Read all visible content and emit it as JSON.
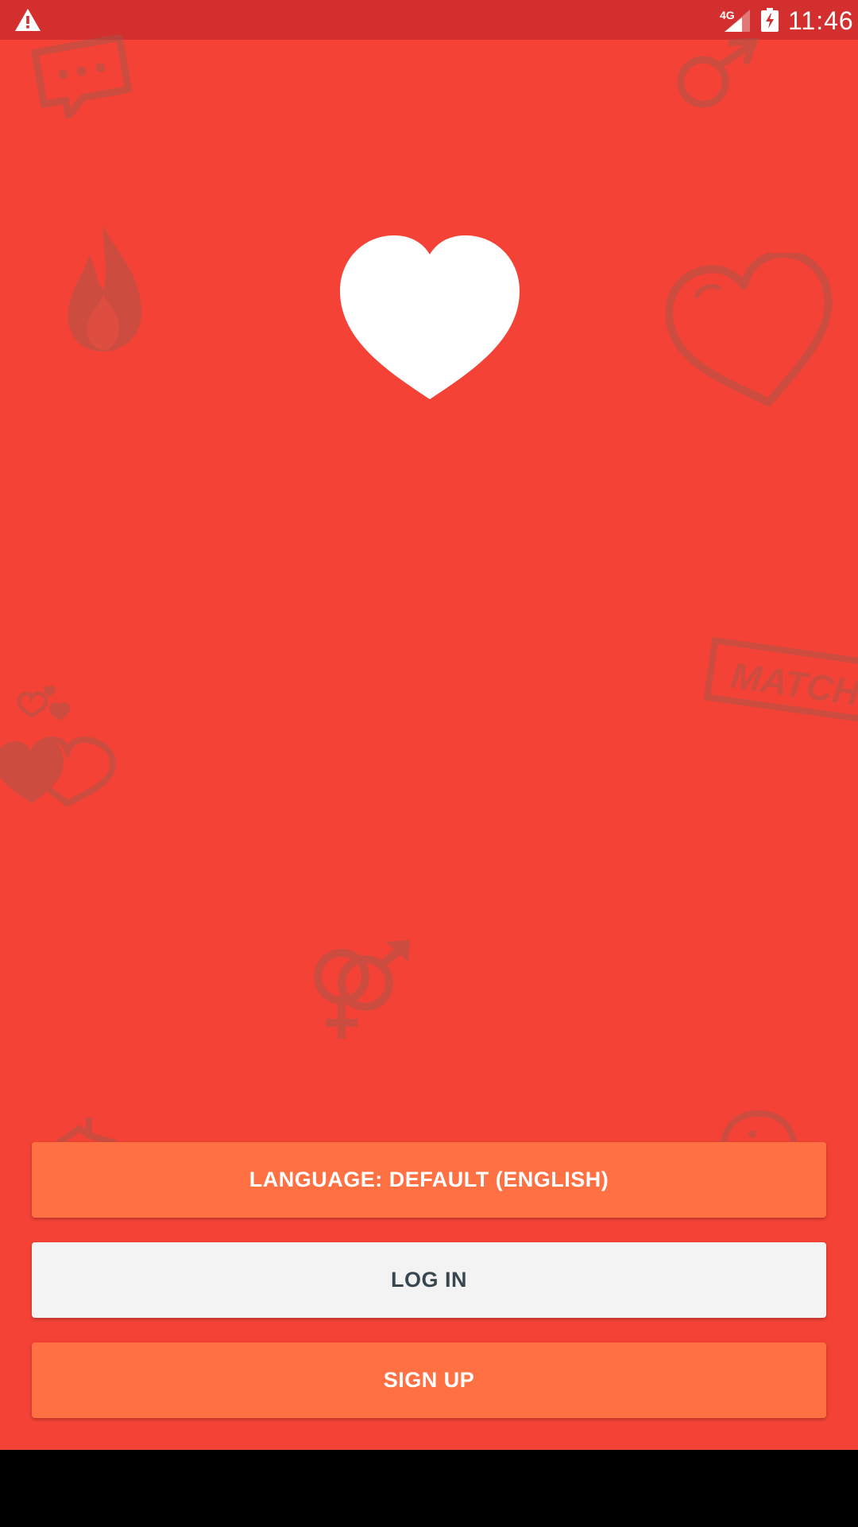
{
  "status_bar": {
    "network_type": "4G",
    "time": "11:46",
    "icons": [
      "warning-icon",
      "signal-icon",
      "battery-charging-icon"
    ],
    "background_color": "#d32f2f"
  },
  "screen": {
    "background_color": "#f44336",
    "logo_icon": "heart-icon",
    "background_decorations": [
      "chat-bubble-icon",
      "male-symbol-icon",
      "flame-icon",
      "outline-heart-icon",
      "match-stamp-icon",
      "hearts-cluster-icon",
      "gender-symbols-icon"
    ],
    "match_stamp_text": "MATCH"
  },
  "buttons": {
    "language_label": "LANGUAGE: DEFAULT (ENGLISH)",
    "login_label": "LOG IN",
    "signup_label": "SIGN UP",
    "accent_color": "#ff7043",
    "login_color": "#f3f3f3"
  }
}
